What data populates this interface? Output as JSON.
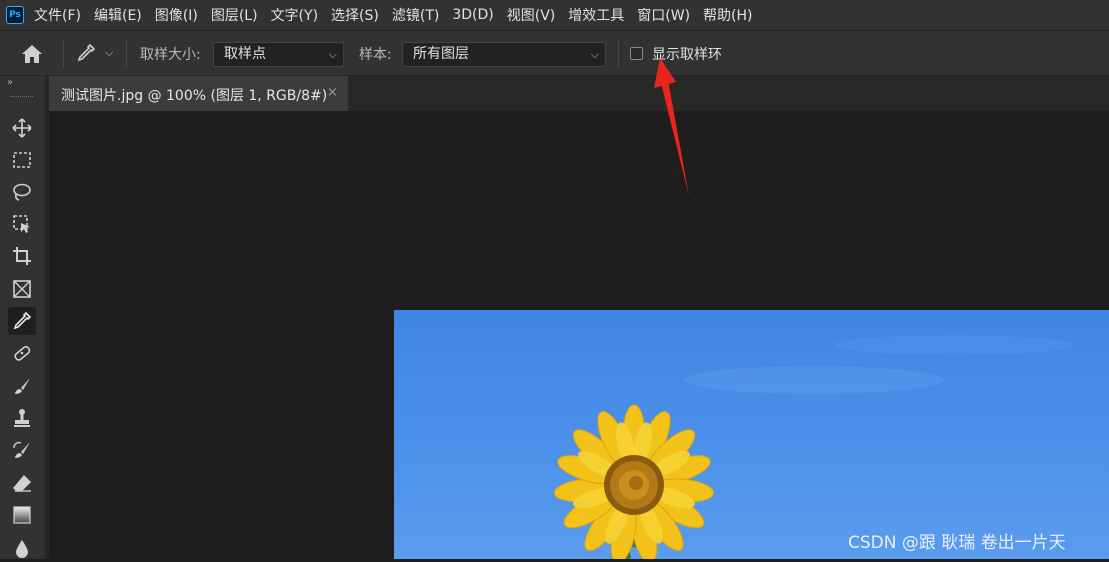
{
  "menubar": {
    "logo": "Ps",
    "items": [
      "文件(F)",
      "编辑(E)",
      "图像(I)",
      "图层(L)",
      "文字(Y)",
      "选择(S)",
      "滤镜(T)",
      "3D(D)",
      "视图(V)",
      "增效工具",
      "窗口(W)",
      "帮助(H)"
    ]
  },
  "options": {
    "sample_size_label": "取样大小:",
    "sample_size_value": "取样点",
    "sample_label": "样本:",
    "sample_value": "所有图层",
    "show_ring_label": "显示取样环",
    "show_ring_checked": false
  },
  "document": {
    "tab_title": "测试图片.jpg @ 100% (图层 1, RGB/8#)",
    "close_glyph": "×"
  },
  "watermark": "CSDN @跟 耿瑞 卷出一片天",
  "colors": {
    "annotation_arrow": "#e8261c",
    "sky": "#4a90ea",
    "petal": "#f2c21b"
  }
}
